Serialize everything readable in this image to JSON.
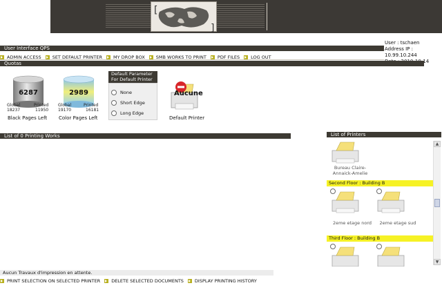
{
  "header": {
    "title": "User Interface QPS",
    "user": "User : tschaen",
    "address": "Address IP : 10.99.10.244",
    "date": "Date : 2010-10-14"
  },
  "nav": [
    {
      "label": "ADMIN ACCESS"
    },
    {
      "label": "SET DEFAULT PRINTER"
    },
    {
      "label": "MY DROP BOX"
    },
    {
      "label": "SMB WORKS TO PRINT"
    },
    {
      "label": "PDF FILES"
    },
    {
      "label": "LOG OUT"
    }
  ],
  "quotas": {
    "title": "Quotas",
    "black": {
      "value": "6287",
      "global_label": "Global",
      "global": "18237",
      "printed_label": "Printed",
      "printed": "11950",
      "label": "Black Pages Left"
    },
    "color": {
      "value": "2989",
      "global_label": "Global",
      "global": "19170",
      "printed_label": "Printed",
      "printed": "16181",
      "label": "Color Pages Left"
    }
  },
  "param": {
    "title_1": "Default Parameter",
    "title_2": "For Default Printer",
    "options": [
      "None",
      "Short Edge",
      "Long Edge"
    ]
  },
  "default_printer": {
    "value": "Aucune",
    "label": "Default Printer"
  },
  "works": {
    "title": "List of 0 Printing Works",
    "empty": "Aucun Travaux d'impression en attente."
  },
  "actions": [
    {
      "label": "PRINT SELECTION ON SELECTED PRINTER"
    },
    {
      "label": "DELETE SELECTED DOCUMENTS"
    },
    {
      "label": "DISPLAY PRINTING HISTORY"
    }
  ],
  "printers": {
    "title": "List of Printers",
    "first_name_1": "Bureau Claire-",
    "first_name_2": "Annaick-Amelie",
    "floors": [
      {
        "name": "Second Floor : Building B",
        "printers": [
          "2eme etage nord",
          "2eme etage sud"
        ]
      },
      {
        "name": "Third Floor : Building B"
      }
    ]
  },
  "colors": {
    "banner": "#3c3935",
    "bar": "#3d3a33",
    "floor": "#f6f225",
    "bullet": "#b8b020"
  }
}
